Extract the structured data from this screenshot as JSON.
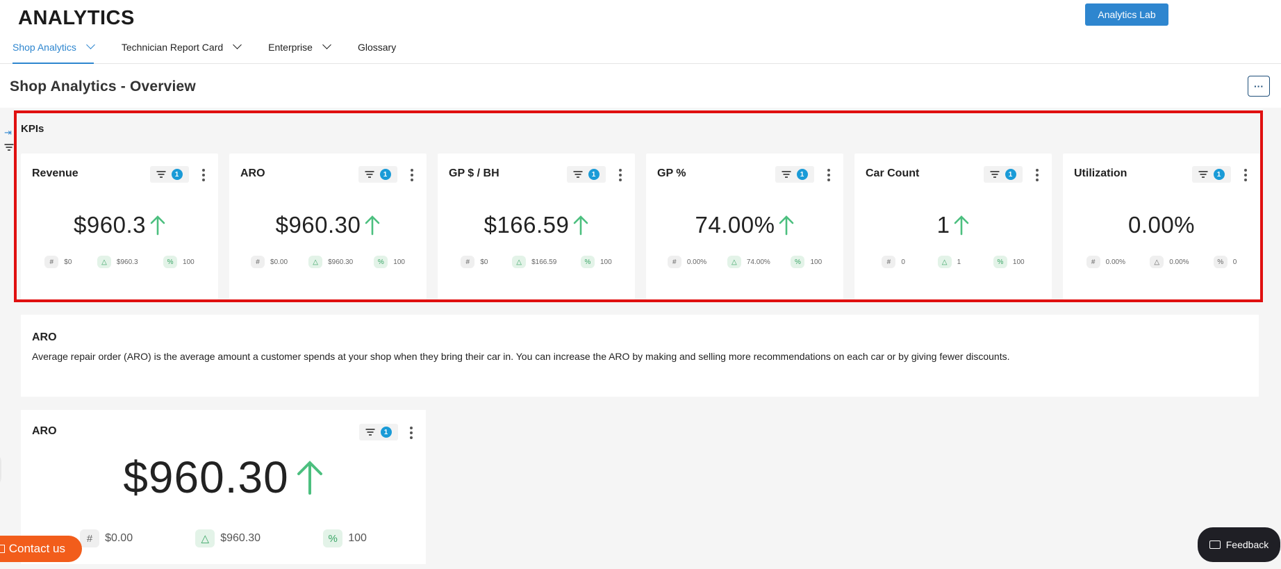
{
  "app": {
    "title": "ANALYTICS",
    "lab_button": "Analytics Lab"
  },
  "nav": [
    {
      "label": "Shop Analytics",
      "has_dropdown": true,
      "active": true
    },
    {
      "label": "Technician Report Card",
      "has_dropdown": true,
      "active": false
    },
    {
      "label": "Enterprise",
      "has_dropdown": true,
      "active": false
    },
    {
      "label": "Glossary",
      "has_dropdown": false,
      "active": false
    }
  ],
  "page": {
    "title": "Shop Analytics - Overview",
    "more_label": "···"
  },
  "kpis": {
    "section_title": "KPIs",
    "cards": [
      {
        "name": "Revenue",
        "filter_count": "1",
        "value": "$960.3",
        "trend": "up",
        "stats": {
          "hash": "$0",
          "delta": "$960.3",
          "pct": "100"
        }
      },
      {
        "name": "ARO",
        "filter_count": "1",
        "value": "$960.30",
        "trend": "up",
        "stats": {
          "hash": "$0.00",
          "delta": "$960.30",
          "pct": "100"
        }
      },
      {
        "name": "GP $ / BH",
        "filter_count": "1",
        "value": "$166.59",
        "trend": "up",
        "stats": {
          "hash": "$0",
          "delta": "$166.59",
          "pct": "100"
        }
      },
      {
        "name": "GP %",
        "filter_count": "1",
        "value": "74.00%",
        "trend": "up",
        "stats": {
          "hash": "0.00%",
          "delta": "74.00%",
          "pct": "100"
        }
      },
      {
        "name": "Car Count",
        "filter_count": "1",
        "value": "1",
        "trend": "up",
        "stats": {
          "hash": "0",
          "delta": "1",
          "pct": "100"
        }
      },
      {
        "name": "Utilization",
        "filter_count": "1",
        "value": "0.00%",
        "trend": "none",
        "stats": {
          "hash": "0.00%",
          "delta": "0.00%",
          "pct": "0"
        }
      }
    ]
  },
  "aro_description": {
    "title": "ARO",
    "text": "Average repair order (ARO) is the average amount a customer spends at your shop when they bring their car in. You can increase the ARO by making and selling more recommendations on each car or by giving fewer discounts."
  },
  "aro_card": {
    "name": "ARO",
    "filter_count": "1",
    "value": "$960.30",
    "trend": "up",
    "stats": {
      "hash": "$0.00",
      "delta": "$960.30",
      "pct": "100"
    }
  },
  "stat_icons": {
    "hash": "#",
    "delta": "△",
    "pct": "%"
  },
  "floating": {
    "contact": "Contact us",
    "feedback": "Feedback"
  },
  "colors": {
    "accent": "#2e86cf",
    "up": "#4cbf7f",
    "highlight": "#e01010",
    "contact": "#f25d1b",
    "badge": "#1a9bd7"
  },
  "icons": {
    "trend_up": "arrow-up-icon",
    "filter": "filter-icon",
    "menu": "kebab-icon",
    "collapse": "collapse-arrow-icon"
  }
}
